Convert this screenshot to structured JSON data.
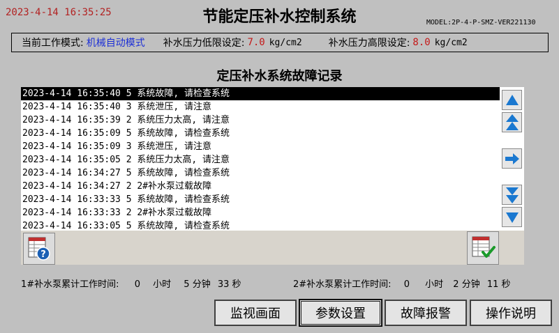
{
  "header": {
    "datetime": "2023-4-14 16:35:25",
    "title": "节能定压补水控制系统",
    "model": "MODEL:2P-4-P-SMZ-VER221130"
  },
  "mode_bar": {
    "mode_label": "当前工作模式:",
    "mode_value": "机械自动模式",
    "low_label": "补水压力低限设定:",
    "low_value": "7.0",
    "low_unit": "kg/cm2",
    "high_label": "补水压力高限设定:",
    "high_value": "8.0",
    "high_unit": "kg/cm2"
  },
  "fault_log": {
    "title": "定压补水系统故障记录",
    "rows": [
      "2023-4-14 16:35:40 5 系统故障, 请检查系统",
      "2023-4-14 16:35:40 3 系统泄压, 请注意",
      "2023-4-14 16:35:39 2 系统压力太高, 请注意",
      "2023-4-14 16:35:09 5 系统故障, 请检查系统",
      "2023-4-14 16:35:09 3 系统泄压, 请注意",
      "2023-4-14 16:35:05 2 系统压力太高, 请注意",
      "2023-4-14 16:34:27 5 系统故障, 请检查系统",
      "2023-4-14 16:34:27 2 2#补水泵过载故障",
      "2023-4-14 16:33:33 5 系统故障, 请检查系统",
      "2023-4-14 16:33:33 2 2#补水泵过载故障",
      "2023-4-14 16:33:05 5 系统故障, 请检查系统"
    ]
  },
  "icons": {
    "scroll_up": "arrow-up-icon",
    "page_up": "double-arrow-up-icon",
    "go": "arrow-right-icon",
    "page_down": "double-arrow-down-icon",
    "scroll_down": "arrow-down-icon",
    "help": "help-table-icon",
    "confirm": "table-check-icon"
  },
  "runtime": {
    "pump1_label": "1#补水泵累计工作时间:",
    "pump1_hours": "0",
    "pump1_hours_unit": "小时",
    "pump1_minutes": "5",
    "pump1_minutes_unit": "分钟",
    "pump1_seconds": "33",
    "pump1_seconds_unit": "秒",
    "pump2_label": "2#补水泵累计工作时间:",
    "pump2_hours": "0",
    "pump2_hours_unit": "小时",
    "pump2_minutes": "2",
    "pump2_minutes_unit": "分钟",
    "pump2_seconds": "11",
    "pump2_seconds_unit": "秒"
  },
  "nav": {
    "monitor": "监视画面",
    "params": "参数设置",
    "alarms": "故障报警",
    "help": "操作说明"
  },
  "colors": {
    "background": "#c0c0c0",
    "accent_blue": "#1c2fd6",
    "value_red": "#c41818",
    "arrow_blue": "#1a78d0"
  }
}
